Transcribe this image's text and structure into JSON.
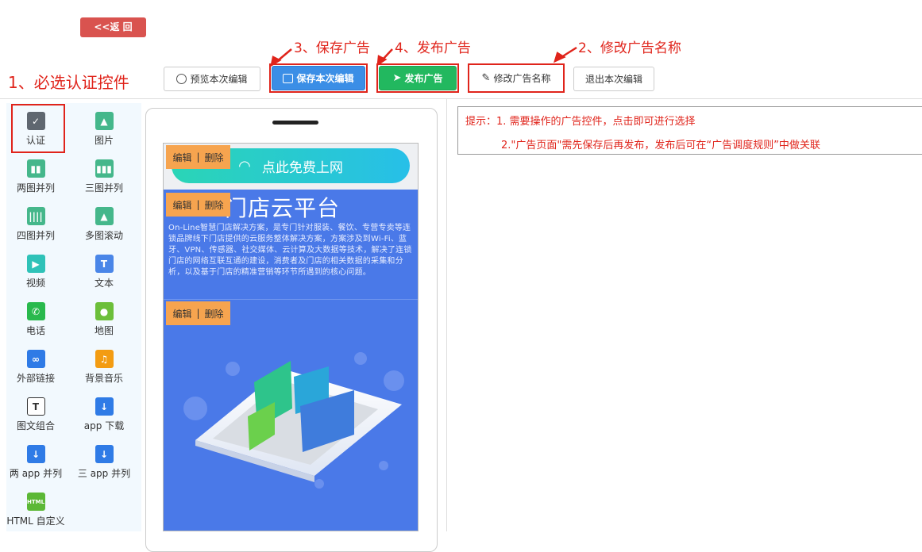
{
  "header": {
    "back_label": "<<返 回"
  },
  "annotations": {
    "a1": "1、必选认证控件",
    "a2": "2、修改广告名称",
    "a3": "3、保存广告",
    "a4": "4、发布广告"
  },
  "toolbar": {
    "preview_label": "预览本次编辑",
    "save_label": "保存本次编辑",
    "publish_label": "发布广告",
    "rename_label": "修改广告名称",
    "exit_label": "退出本次编辑"
  },
  "palette": {
    "items": [
      {
        "label": "认证",
        "icon": "check-icon",
        "color": "#5f6770"
      },
      {
        "label": "图片",
        "icon": "image-icon",
        "color": "#45b78b"
      },
      {
        "label": "两图并列",
        "icon": "two-images-icon",
        "color": "#45b78b"
      },
      {
        "label": "三图并列",
        "icon": "three-images-icon",
        "color": "#45b78b"
      },
      {
        "label": "四图并列",
        "icon": "four-images-icon",
        "color": "#45b78b"
      },
      {
        "label": "多图滚动",
        "icon": "carousel-icon",
        "color": "#45b78b"
      },
      {
        "label": "视频",
        "icon": "play-icon",
        "color": "#2fc2b8"
      },
      {
        "label": "文本",
        "icon": "text-icon",
        "color": "#4a86e8"
      },
      {
        "label": "电话",
        "icon": "phone-icon",
        "color": "#29b94d"
      },
      {
        "label": "地图",
        "icon": "map-pin-icon",
        "color": "#6cbf3a"
      },
      {
        "label": "外部链接",
        "icon": "link-icon",
        "color": "#2f7be6"
      },
      {
        "label": "背景音乐",
        "icon": "music-icon",
        "color": "#f39c12"
      },
      {
        "label": "图文组合",
        "icon": "image-text-icon",
        "color": "#333333"
      },
      {
        "label": "app 下载",
        "icon": "download-icon",
        "color": "#2f7be6"
      },
      {
        "label": "两 app 并列",
        "icon": "download-icon",
        "color": "#2f7be6"
      },
      {
        "label": "三 app 并列",
        "icon": "download-icon",
        "color": "#2f7be6"
      },
      {
        "label": "HTML 自定义",
        "icon": "html-icon",
        "color": "#5cb836"
      }
    ]
  },
  "preview": {
    "wifi_label": "点此免费上网",
    "edit": "编辑",
    "sep": "|",
    "delete": "删除",
    "title": "门店云平台",
    "description": "On-Line智慧门店解决方案，是专门针对服装、餐饮、专营专卖等连锁品牌线下门店提供的云服务整体解决方案，方案涉及到Wi-Fi、蓝牙、VPN、传感器、社交媒体、云计算及大数据等技术，解决了连锁门店的网络互联互通的建设，消费者及门店的相关数据的采集和分析，以及基于门店的精准营销等环节所遇到的核心问题。"
  },
  "tips": {
    "line1": "提示：1. 需要操作的广告控件，点击即可进行选择",
    "line2": "2.\"广告页面\"需先保存后再发布，发布后可在“广告调度规则”中做关联"
  },
  "colors": {
    "accent_red": "#e0241b",
    "save_blue": "#3b8ee6",
    "publish_green": "#22b85f",
    "screen_blue": "#4a79e8",
    "edit_tag_orange": "#f6a44f"
  }
}
